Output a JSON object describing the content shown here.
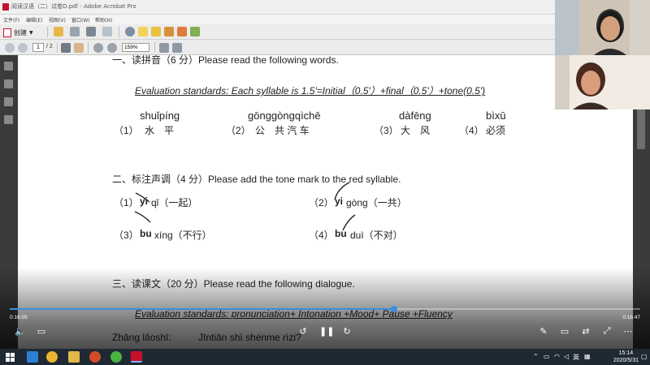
{
  "window": {
    "title": "阅读汉语（二）试卷D.pdf - Adobe Acrobat Pro",
    "menu": [
      "文件(F)",
      "编辑(E)",
      "视图(V)",
      "窗口(W)",
      "帮助(H)"
    ]
  },
  "toolbar": {
    "create_label": "创建",
    "page_current": "1",
    "page_total": "/ 2",
    "zoom": "159%"
  },
  "document": {
    "section1_heading": "一、读拼音（6 分）Please read the following words.",
    "section1_standard": "Evaluation standards: Each syllable is 1.5'=Initial（0.5'）+final（0.5'）+tone(0.5')",
    "words": [
      {
        "pinyin": "shuǐpíng",
        "num": "（1）",
        "hanzi": "水　平"
      },
      {
        "pinyin": "gōnggòngqìchē",
        "num": "（2）",
        "hanzi": "公　共 汽 车"
      },
      {
        "pinyin": "dàfēng",
        "num": "（3）",
        "hanzi": "大　风"
      },
      {
        "pinyin": "bìxū",
        "num": "（4）",
        "hanzi": "必须"
      }
    ],
    "section2_heading": "二、标注声调（4 分）Please add the tone mark to the red syllable.",
    "tones": [
      {
        "num": "（1）",
        "red": "yi",
        "rest": "qǐ（一起）"
      },
      {
        "num": "（2）",
        "red": "yi",
        "rest": "gòng（一共）"
      },
      {
        "num": "（3）",
        "red": "bu",
        "rest": "xíng（不行）"
      },
      {
        "num": "（4）",
        "red": "bu",
        "rest": "duì（不对）"
      }
    ],
    "section3_heading": "三、读课文（20 分）Please read the following dialogue.",
    "section3_standard": "Evaluation standards: pronunciation+ Intonation +Mood+ Pause +Fluency",
    "dialogue_speaker": "Zhāng lǎoshī:",
    "dialogue_line": "Jīntiān shì shénme rìzi?"
  },
  "player": {
    "time_elapsed": "0:16:05",
    "time_total": "0:16:47",
    "progress": 0.61
  },
  "taskbar": {
    "ime": "英",
    "time": "15:14",
    "date": "2020/5/31"
  },
  "colors": {
    "red_syllable": "#cc1a1a",
    "progress_blue": "#3c8dde",
    "taskbar": "#1f2933"
  }
}
